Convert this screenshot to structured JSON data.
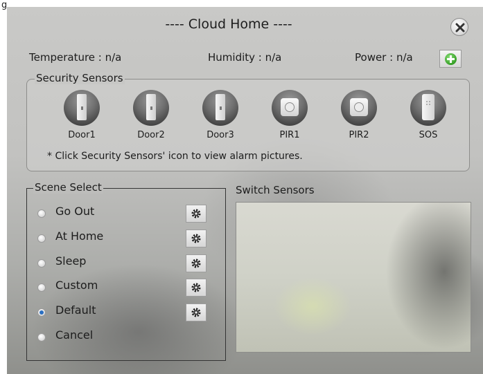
{
  "header": {
    "top_label": "g"
  },
  "window": {
    "title": "---- Cloud Home ----",
    "close_icon": "close-icon",
    "add_icon": "plus-icon"
  },
  "status": {
    "temperature": "Temperature : n/a",
    "humidity": "Humidity : n/a",
    "power": "Power : n/a"
  },
  "security": {
    "legend": "Security Sensors",
    "sensors": [
      {
        "label": "Door1",
        "icon": "door-sensor-icon"
      },
      {
        "label": "Door2",
        "icon": "door-sensor-icon"
      },
      {
        "label": "Door3",
        "icon": "door-sensor-icon"
      },
      {
        "label": "PIR1",
        "icon": "pir-sensor-icon"
      },
      {
        "label": "PIR2",
        "icon": "pir-sensor-icon"
      },
      {
        "label": "SOS",
        "icon": "sos-remote-icon"
      }
    ],
    "hint": "* Click Security Sensors' icon to view alarm pictures."
  },
  "scene": {
    "legend": "Scene Select",
    "selected": "Default",
    "options": [
      {
        "label": "Go Out",
        "has_settings": true
      },
      {
        "label": "At Home",
        "has_settings": true
      },
      {
        "label": "Sleep",
        "has_settings": true
      },
      {
        "label": "Custom",
        "has_settings": true
      },
      {
        "label": "Default",
        "has_settings": true
      },
      {
        "label": "Cancel",
        "has_settings": false
      }
    ]
  },
  "switch": {
    "title": "Switch Sensors"
  }
}
